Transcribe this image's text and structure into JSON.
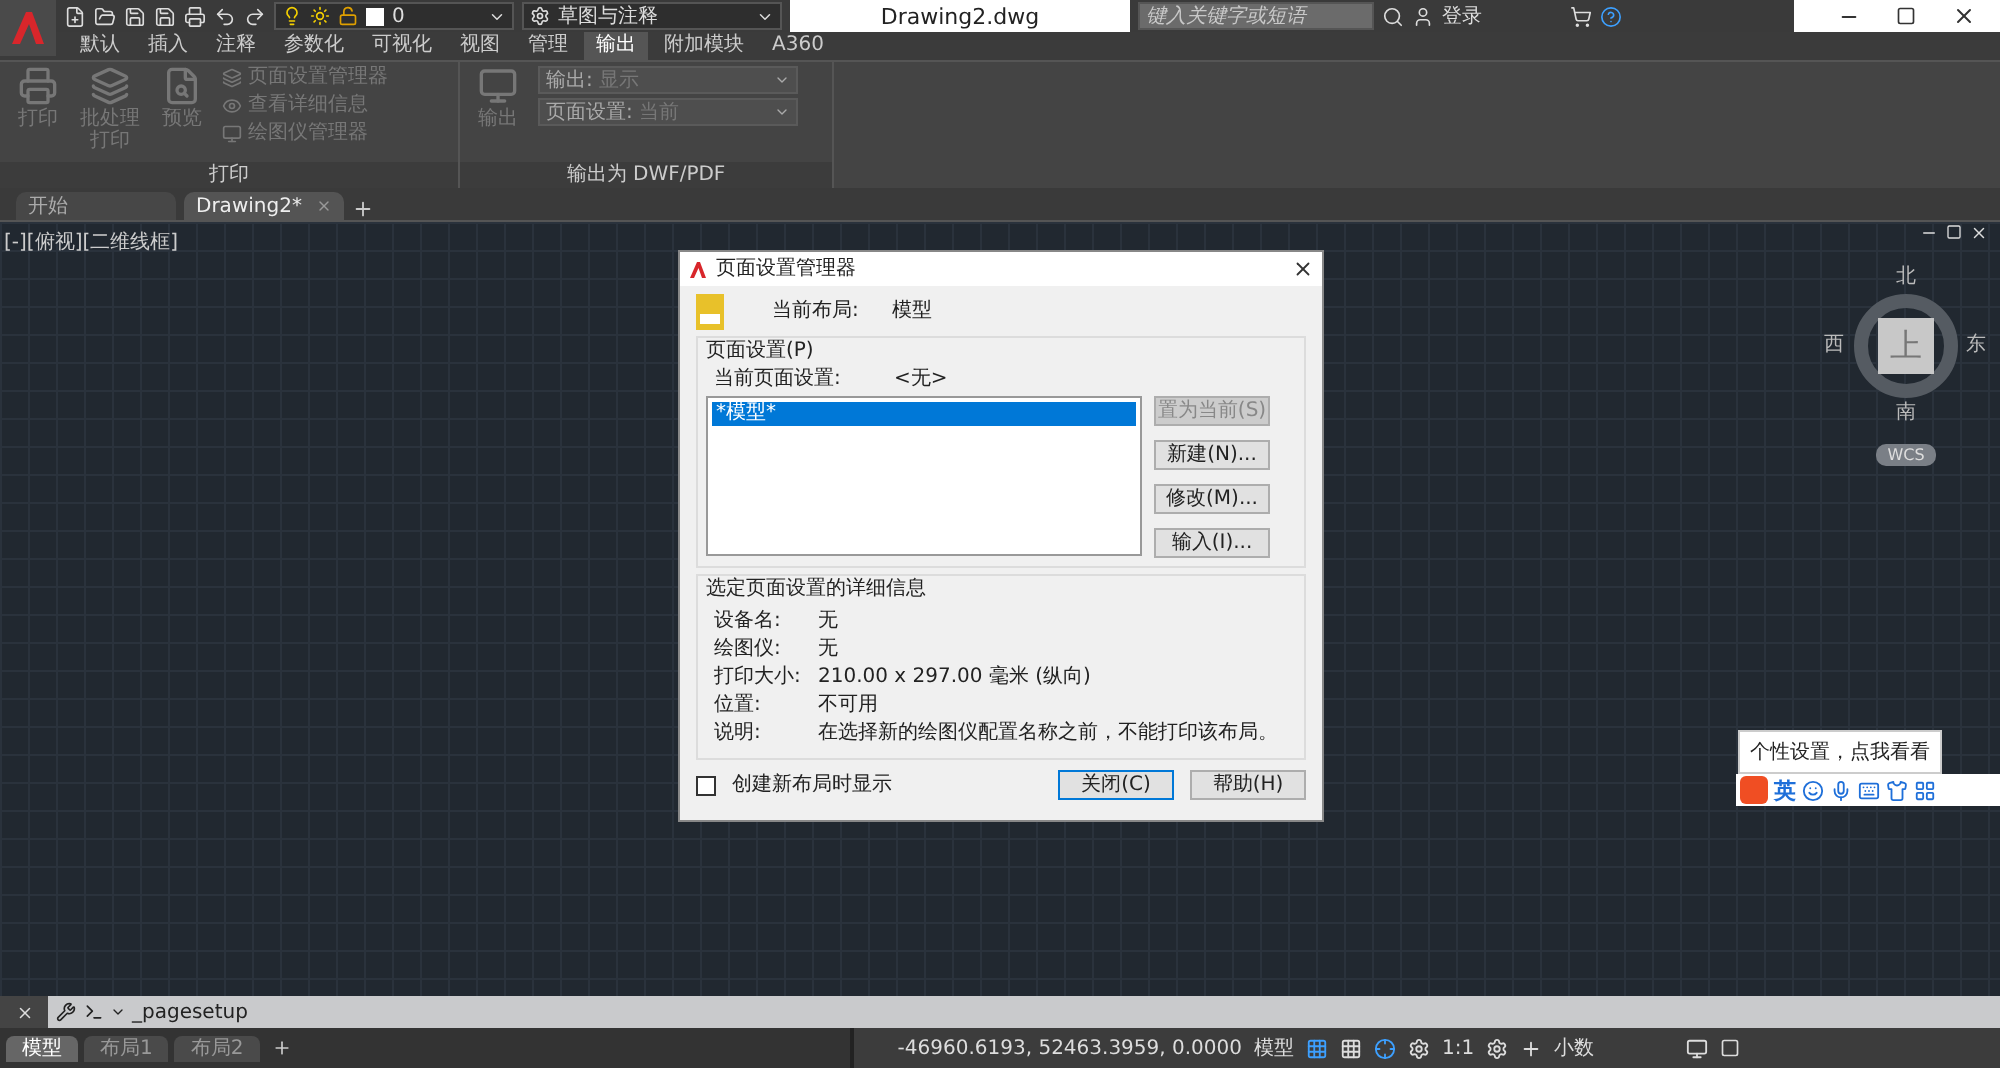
{
  "quick_access": {
    "layer": "0",
    "workspace": "草图与注释"
  },
  "title": "Drawing2.dwg",
  "search": {
    "placeholder": "键入关键字或短语"
  },
  "signin": "登录",
  "ribbon_tabs": [
    {
      "label": "默认",
      "selected": false
    },
    {
      "label": "插入",
      "selected": false
    },
    {
      "label": "注释",
      "selected": false
    },
    {
      "label": "参数化",
      "selected": false
    },
    {
      "label": "可视化",
      "selected": false
    },
    {
      "label": "视图",
      "selected": false
    },
    {
      "label": "管理",
      "selected": false
    },
    {
      "label": "输出",
      "selected": true
    },
    {
      "label": "附加模块",
      "selected": false
    },
    {
      "label": "A360",
      "selected": false
    }
  ],
  "ribbon": {
    "print_panel": {
      "title": "打印",
      "big_buttons": [
        {
          "kind": "print",
          "label": "打印",
          "disabled": true
        },
        {
          "kind": "batch",
          "label": "批处理打印",
          "disabled": true
        },
        {
          "kind": "preview",
          "label": "预览",
          "disabled": true
        }
      ],
      "small_buttons": [
        {
          "kind": "pagesetup",
          "label": "页面设置管理器",
          "disabled": true
        },
        {
          "kind": "details",
          "label": "查看详细信息",
          "disabled": true
        },
        {
          "kind": "plotter",
          "label": "绘图仪管理器",
          "disabled": true
        }
      ]
    },
    "export_panel": {
      "title": "输出为 DWF/PDF",
      "button": {
        "label": "输出",
        "disabled": true
      },
      "dropdowns": [
        {
          "label": "输出:",
          "value": "显示"
        },
        {
          "label": "页面设置:",
          "value": "当前"
        }
      ]
    }
  },
  "doc_tabs": [
    {
      "label": "开始",
      "selected": false
    },
    {
      "label": "Drawing2*",
      "selected": true
    }
  ],
  "viewport_label": "[-][俯视][二维线框]",
  "viewcube": {
    "north": "北",
    "south": "南",
    "east": "东",
    "west": "西",
    "face": "上",
    "ucs": "WCS"
  },
  "dialog": {
    "title": "页面设置管理器",
    "current_layout_label": "当前布局:",
    "current_layout": "模型",
    "group_title": "页面设置(P)",
    "current_setup_label": "当前页面设置:",
    "current_setup": "<无>",
    "list": [
      {
        "label": "*模型*",
        "selected": true
      }
    ],
    "buttons": [
      {
        "label": "置为当前(S)",
        "disabled": true
      },
      {
        "label": "新建(N)...",
        "disabled": false
      },
      {
        "label": "修改(M)...",
        "disabled": false
      },
      {
        "label": "输入(I)...",
        "disabled": false
      }
    ],
    "details_title": "选定页面设置的详细信息",
    "details": [
      {
        "label": "设备名:",
        "value": "无"
      },
      {
        "label": "绘图仪:",
        "value": "无"
      },
      {
        "label": "打印大小:",
        "value": "210.00 x 297.00 毫米 (纵向)"
      },
      {
        "label": "位置:",
        "value": "不可用"
      },
      {
        "label": "说明:",
        "value": "在选择新的绘图仪配置名称之前，不能打印该布局。"
      }
    ],
    "checkbox": {
      "label": "创建新布局时显示",
      "checked": false
    },
    "footer_buttons": [
      {
        "label": "关闭(C)",
        "default": true
      },
      {
        "label": "帮助(H)",
        "default": false
      }
    ]
  },
  "ime": {
    "tooltip": "个性设置，点我看看",
    "lang": "英"
  },
  "command": {
    "text": "_pagesetup"
  },
  "layout_tabs": [
    {
      "label": "模型",
      "selected": true
    },
    {
      "label": "布局1",
      "selected": false
    },
    {
      "label": "布局2",
      "selected": false
    }
  ],
  "status": {
    "coords": "-46960.6193, 52463.3959, 0.0000",
    "space": "模型",
    "scale": "1:1",
    "units": "小数"
  }
}
